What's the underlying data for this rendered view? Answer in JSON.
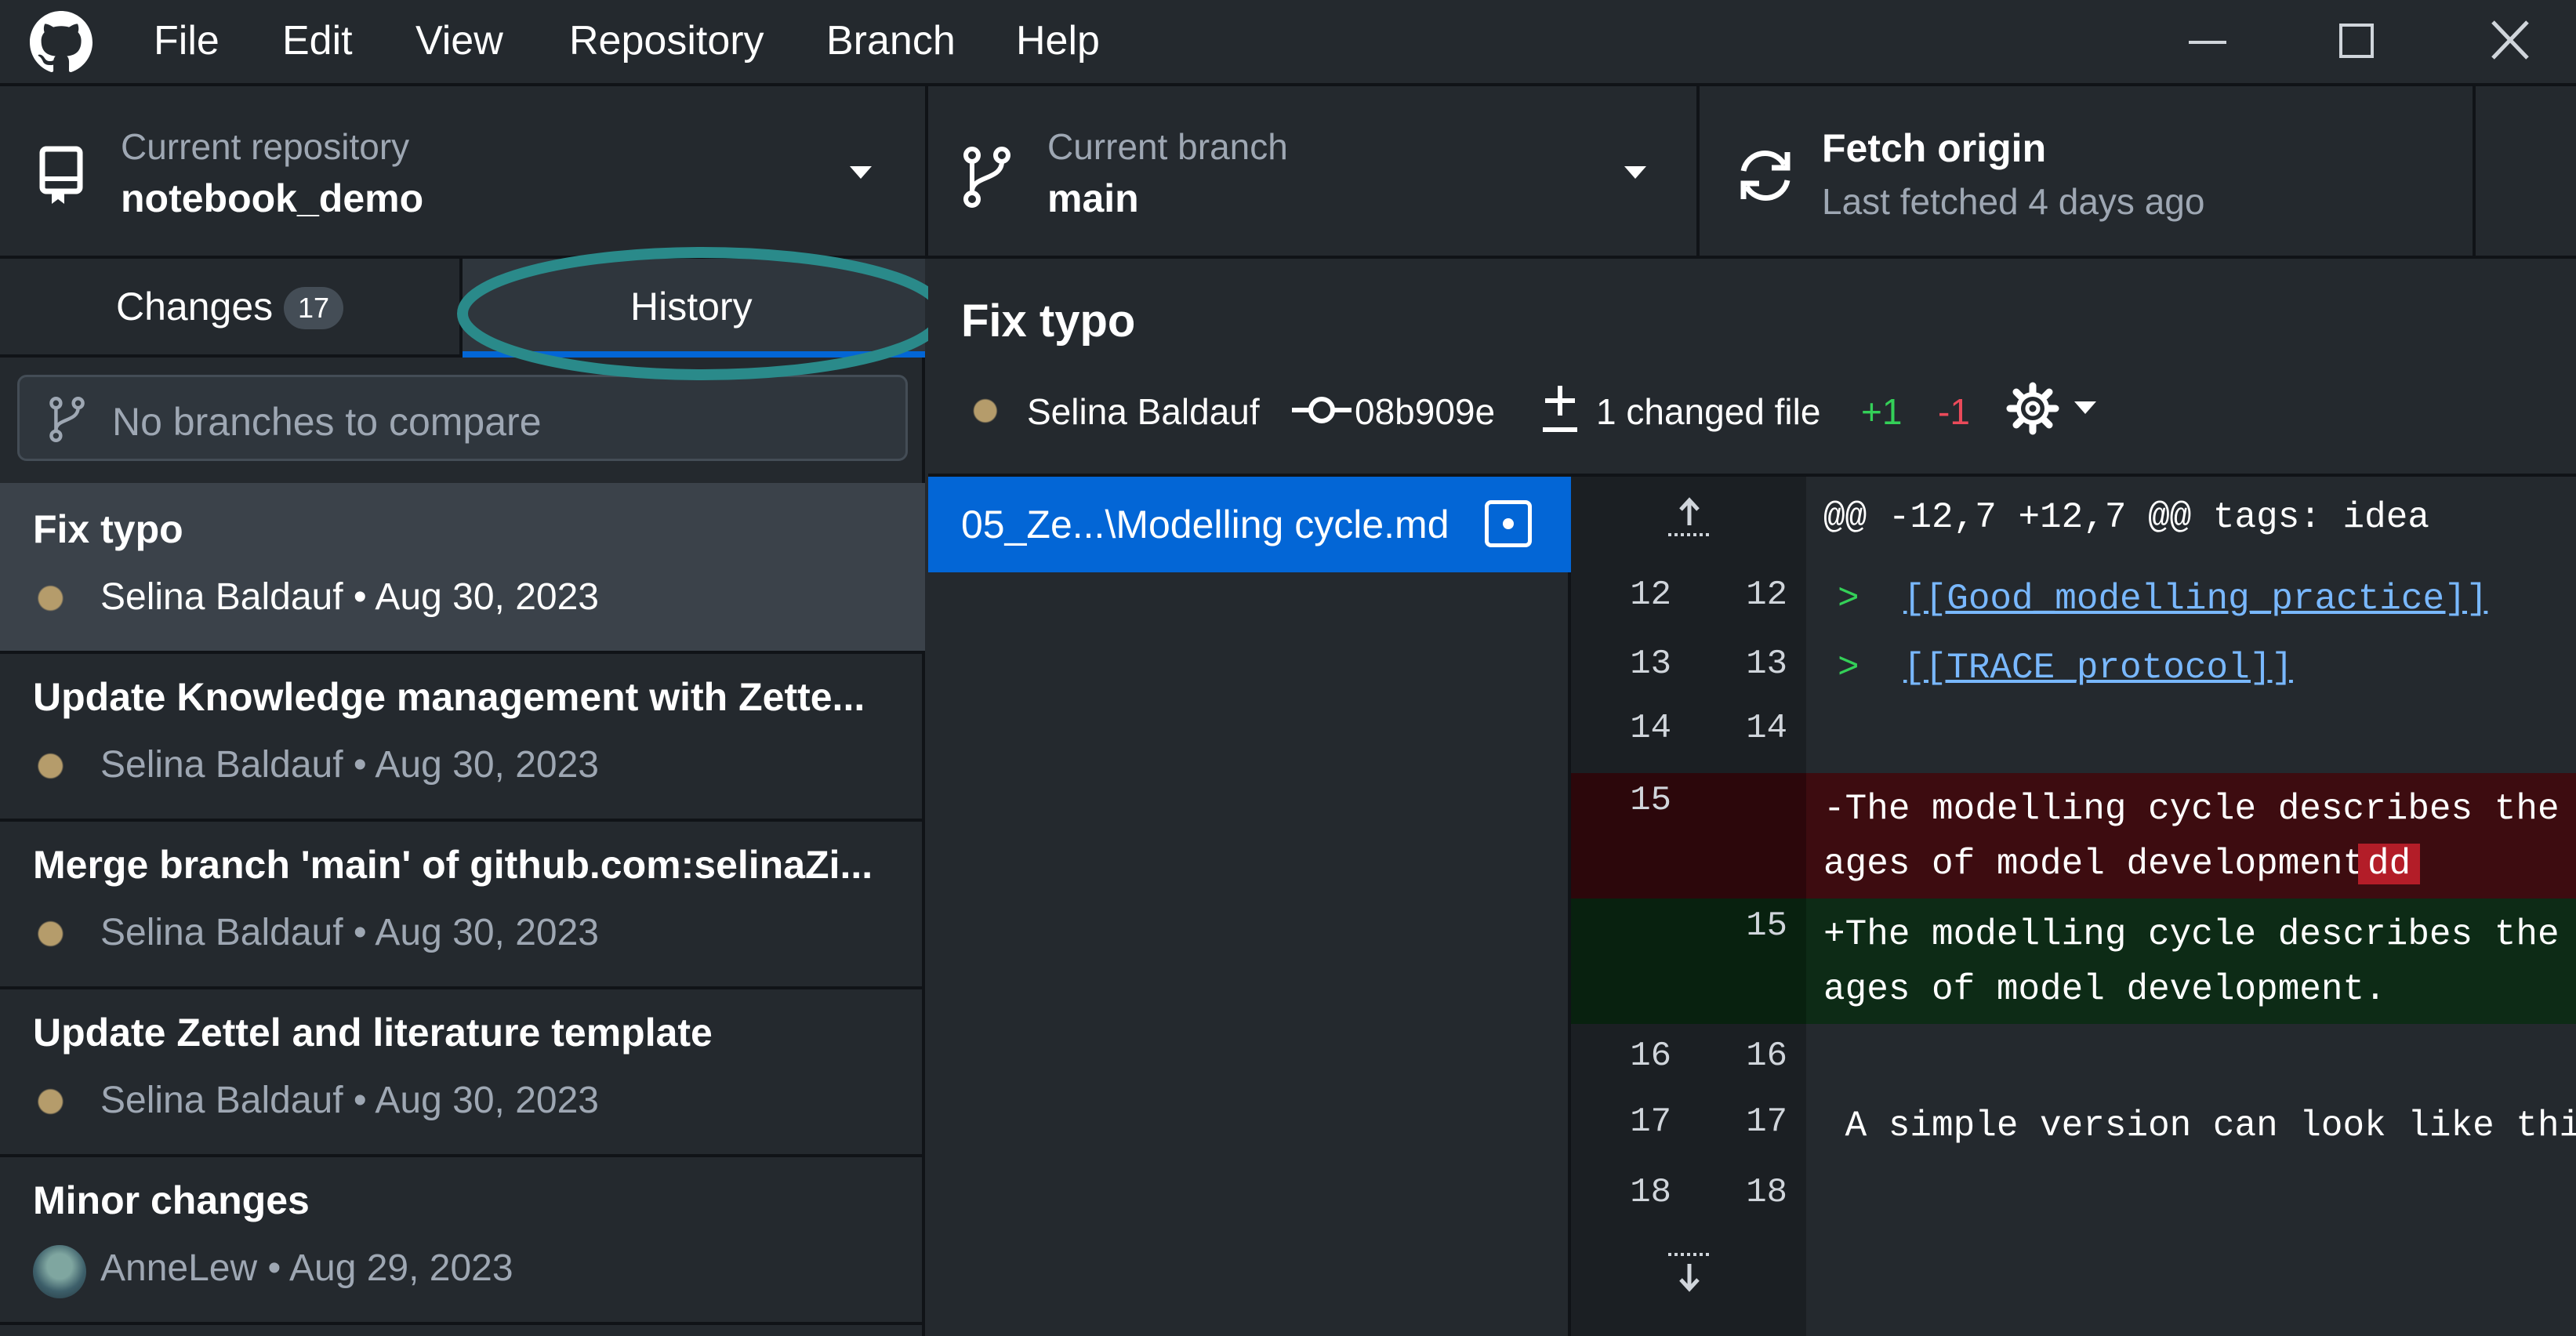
{
  "menu": [
    "File",
    "Edit",
    "View",
    "Repository",
    "Branch",
    "Help"
  ],
  "toolbar": {
    "repo_label": "Current repository",
    "repo_value": "notebook_demo",
    "branch_label": "Current branch",
    "branch_value": "main",
    "fetch_title": "Fetch origin",
    "fetch_sub": "Last fetched 4 days ago"
  },
  "tabs": {
    "changes_label": "Changes",
    "changes_count": "17",
    "history_label": "History"
  },
  "branch_compare_placeholder": "No branches to compare",
  "commits": [
    {
      "title": "Fix typo",
      "meta": "Selina Baldauf • Aug 30, 2023"
    },
    {
      "title": "Update Knowledge management with Zette...",
      "meta": "Selina Baldauf • Aug 30, 2023"
    },
    {
      "title": "Merge branch 'main' of github.com:selinaZi...",
      "meta": "Selina Baldauf • Aug 30, 2023"
    },
    {
      "title": "Update Zettel and literature template",
      "meta": "Selina Baldauf • Aug 30, 2023"
    },
    {
      "title": "Minor changes",
      "meta": "AnneLew • Aug 29, 2023"
    }
  ],
  "detail": {
    "title": "Fix typo",
    "author": "Selina Baldauf",
    "sha": "08b909e",
    "changed_files": "1 changed file",
    "additions": "+1",
    "deletions": "-1"
  },
  "file": {
    "name": "05_Ze...\\Modelling cycle.md"
  },
  "diff": {
    "hunk_header": "@@ -12,7 +12,7 @@ tags: idea",
    "lines": [
      {
        "old": "12",
        "new": "12",
        "marker": ">",
        "text": "[[Good_modelling_practice]]"
      },
      {
        "old": "13",
        "new": "13",
        "marker": ">",
        "text": "[[TRACE_protocol]]"
      },
      {
        "old": "14",
        "new": "14",
        "text": ""
      },
      {
        "old": "15",
        "new": "",
        "text1": "-The modelling cycle describes the st",
        "text2": "ages of model development.",
        "hl": "dd"
      },
      {
        "old": "",
        "new": "15",
        "text1": "+The modelling cycle describes the st",
        "text2": "ages of model development."
      },
      {
        "old": "16",
        "new": "16",
        "text": ""
      },
      {
        "old": "17",
        "new": "17",
        "text": " A simple version can look like this:"
      },
      {
        "old": "18",
        "new": "18",
        "text": ""
      }
    ]
  },
  "colors": {
    "accent": "#0366d6",
    "annotation_circle": "#2a8a8a",
    "added_bg": "#0d2b16",
    "removed_bg": "#3d0c10",
    "add_text": "#34d058",
    "del_text": "#ea4a5a"
  }
}
